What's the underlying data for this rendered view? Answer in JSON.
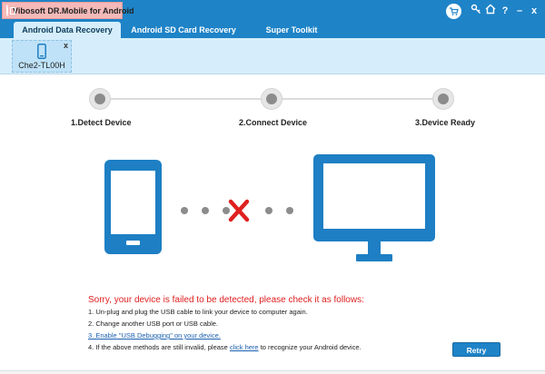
{
  "window": {
    "title": "Vibosoft DR.Mobile for Android",
    "controls": [
      "?",
      "–",
      "x"
    ]
  },
  "tabs": [
    {
      "label": "Android Data Recovery",
      "active": true
    },
    {
      "label": "Android SD Card Recovery",
      "active": false
    },
    {
      "label": "Super Toolkit",
      "active": false
    }
  ],
  "device": {
    "name": "Che2-TL00H",
    "close": "x"
  },
  "steps": [
    {
      "label": "1.Detect Device"
    },
    {
      "label": "2.Connect Device"
    },
    {
      "label": "3.Device Ready"
    }
  ],
  "message": {
    "title": "Sorry, your device is failed to be detected, please check it as follows:",
    "tips": [
      "1. Un-plug and plug the USB cable to link your device to computer again.",
      "2. Change another USB port or USB cable.",
      "3. Enable \"USB Debugging\" on your device."
    ],
    "tip4": {
      "before": "4. If the above methods are still invalid, please ",
      "link": "click here",
      "after": " to recognize your Android device."
    }
  },
  "retry_label": "Retry",
  "colors": {
    "accent": "#1e83c7",
    "error": "#e02020",
    "device_blue": "#1e7fc4"
  }
}
